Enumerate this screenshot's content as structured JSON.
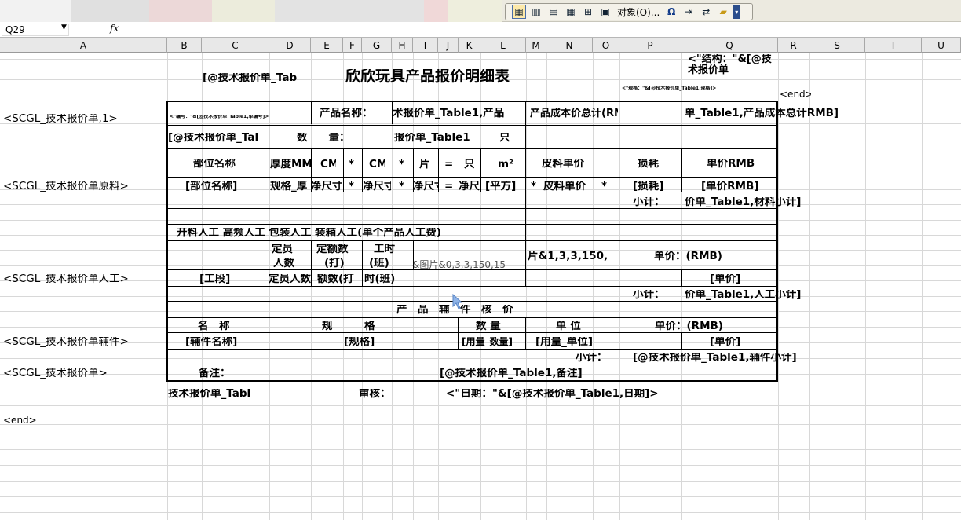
{
  "toolbar": {
    "items": [
      "table-icon",
      "table-icon",
      "table-icon",
      "table-icon",
      "columns-icon",
      "picture-icon"
    ],
    "object_label": "对象(O)...",
    "omega": "Ω"
  },
  "formula_bar": {
    "namebox": "Q29",
    "fx": "fx",
    "formula": ""
  },
  "columns": [
    "A",
    "B",
    "C",
    "D",
    "E",
    "F",
    "G",
    "H",
    "I",
    "J",
    "K",
    "L",
    "M",
    "N",
    "O",
    "P",
    "Q",
    "R",
    "S",
    "T",
    "U"
  ],
  "cells": {
    "title": "欣欣玩具产品报价明细表",
    "title_left": "[@技术报价单_Tab",
    "struct": "<\"结构：\"&[@技术报价单",
    "spec_small": "<\"规格：\"&[@技术报价单_Table1,规格]>",
    "end1": "<end>",
    "a_tech": "<SCGL_技术报价单,1>",
    "no_small": "<\"编号：\"&[@技术报价单_Table1,单编号]>",
    "prod_name": "产品名称：",
    "prod_val": "术报价单_Table1,产品",
    "cost_total": "产品成本价总计(RMB)：",
    "cost_val": "单_Table1,产品成本总计RMB]",
    "qty_left": "[@技术报价单_Tal",
    "qty": "数　　量：",
    "qty_val": "报价单_Table1",
    "zhi": "只",
    "h_part": "部位名称",
    "h_thick": "厚度MM",
    "h_cm1": "CM",
    "h_x1": "*",
    "h_cm2": "CM",
    "h_x2": "*",
    "h_pian": "片",
    "h_eq": "=",
    "h_zhi": "只",
    "h_m2": "m²",
    "h_leather": "皮料单价",
    "h_loss": "损耗",
    "h_unit": "单价RMB",
    "a_raw": "<SCGL_技术报价单原料>",
    "r_part": "[部位名称]",
    "r_spec": "规格_厚",
    "r_size1": "净尺寸",
    "r_x1": "*",
    "r_size2": "净尺寸",
    "r_x2": "*",
    "r_size3": "净尺寸",
    "r_eq": "=",
    "r_size4": "净尺",
    "r_sq": "[平方]",
    "r_x3": "*",
    "r_leather": "皮料单价",
    "r_x4": "*",
    "r_loss": "[损耗]",
    "r_unit": "[单价RMB]",
    "subtotal1": "小计：",
    "subtotal1_val": "价单_Table1,材料小计]",
    "labor_head": "开料人工 高频人工 包装人工 装箱人工(单个产品人工费)",
    "staff1": "定员",
    "staff2": "人数",
    "quota1": "定额数",
    "quota2": "(打)",
    "hours1": "工时",
    "hours2": "(班)",
    "pic1": "&图片&0,3,3,150,15",
    "pic2": "片&1,3,3,150,",
    "unit_price1": "单价：(RMB)",
    "a_labor": "<SCGL_技术报价单人工>",
    "l_stage": "[工段]",
    "l_staff": "定员人数",
    "l_quota": "额数(打",
    "l_hours": "时(班)",
    "l_unit": "[单价]",
    "subtotal2": "小计：",
    "subtotal2_val": "价单_Table1,人工小计]",
    "acc_head": "产　品　辅　件　核　价",
    "acc_name": "名　称",
    "acc_spec": "规　　　格",
    "acc_qty": "数 量",
    "acc_uom": "单 位",
    "acc_price": "单价：(RMB)",
    "a_acc": "<SCGL_技术报价单辅件>",
    "ac_name": "[辅件名称]",
    "ac_spec": "[规格]",
    "ac_qty": "[用量_数量]",
    "ac_uom": "[用量_单位]",
    "ac_unit": "[单价]",
    "subtotal3": "小计：",
    "subtotal3_val": "[@技术报价单_Table1,辅件小计]",
    "a_main": "<SCGL_技术报价单>",
    "remark": "备注：",
    "remark_val": "[@技术报价单_Table1,备注]",
    "maker": "技术报价单_Tabl",
    "review": "审核：",
    "date": "<\"日期：\"&[@技术报价单_Table1,日期]>",
    "end2": "<end>"
  }
}
